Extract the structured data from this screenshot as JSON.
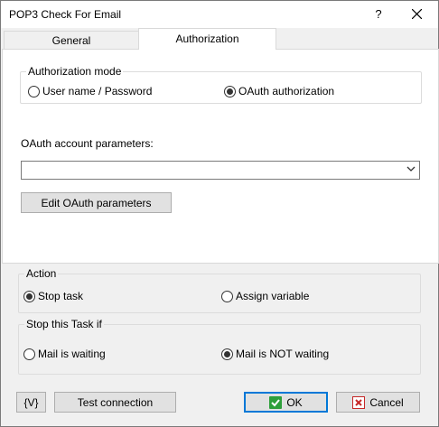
{
  "window": {
    "title": "POP3 Check For Email",
    "help_glyph": "?"
  },
  "tabs": [
    {
      "label": "General",
      "active": false
    },
    {
      "label": "Authorization",
      "active": true
    }
  ],
  "authorization": {
    "group_label": "Authorization mode",
    "options": [
      {
        "label": "User name / Password",
        "checked": false
      },
      {
        "label": "OAuth authorization",
        "checked": true
      }
    ],
    "oauth_account_label": "OAuth account parameters:",
    "oauth_account_value": "",
    "edit_button": "Edit OAuth parameters"
  },
  "action": {
    "group_label": "Action",
    "options": [
      {
        "label": "Stop task",
        "checked": true
      },
      {
        "label": "Assign variable",
        "checked": false
      }
    ]
  },
  "stop_if": {
    "group_label": "Stop this Task if",
    "options": [
      {
        "label": "Mail is waiting",
        "checked": false
      },
      {
        "label": "Mail is NOT waiting",
        "checked": true
      }
    ]
  },
  "footer": {
    "variable_button": "{V}",
    "test_button": "Test connection",
    "ok_button": "OK",
    "cancel_button": "Cancel"
  },
  "icons": {
    "ok": "check-icon",
    "cancel": "x-icon",
    "close": "close-icon",
    "dropdown": "chevron-down-icon"
  }
}
